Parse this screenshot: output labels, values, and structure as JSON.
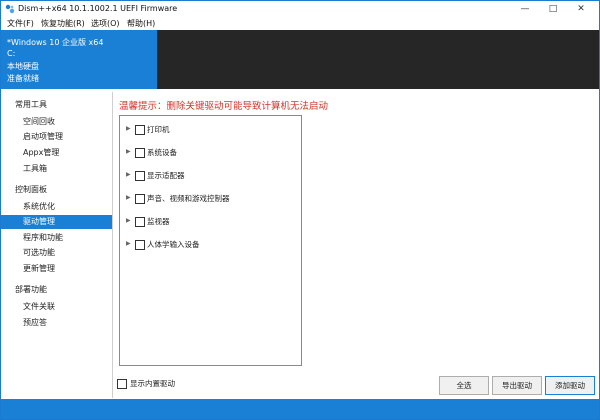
{
  "window": {
    "title": "Dism++x64 10.1.1002.1 UEFI Firmware",
    "controls": {
      "minimize": "—",
      "maximize": "□",
      "close": "✕"
    }
  },
  "menu": [
    "文件(F)",
    "恢复功能(R)",
    "选项(O)",
    "帮助(H)"
  ],
  "header": {
    "lines": [
      "*Windows 10 企业版 x64",
      "C:",
      "本地硬盘",
      "准备就绪"
    ]
  },
  "sidebar": {
    "categories": [
      {
        "label": "常用工具",
        "items": [
          "空间回收",
          "启动项管理",
          "Appx管理",
          "工具箱"
        ]
      },
      {
        "label": "控制面板",
        "items": [
          "系统优化",
          "驱动管理",
          "程序和功能",
          "可选功能",
          "更新管理"
        ]
      },
      {
        "label": "部署功能",
        "items": [
          "文件关联",
          "预应答"
        ]
      }
    ],
    "selected": "驱动管理"
  },
  "main": {
    "warning": "温馨提示：删除关键驱动可能导致计算机无法启动",
    "tree_items": [
      "打印机",
      "系统设备",
      "显示适配器",
      "声音、视频和游戏控制器",
      "监视器",
      "人体学输入设备"
    ],
    "show_builtin_label": "显示内置驱动",
    "buttons": {
      "select_all": "全选",
      "export": "导出驱动",
      "add": "添加驱动"
    }
  },
  "colors": {
    "accent": "#1a80d6",
    "header_dark": "#262626",
    "warning": "#d0362d"
  }
}
